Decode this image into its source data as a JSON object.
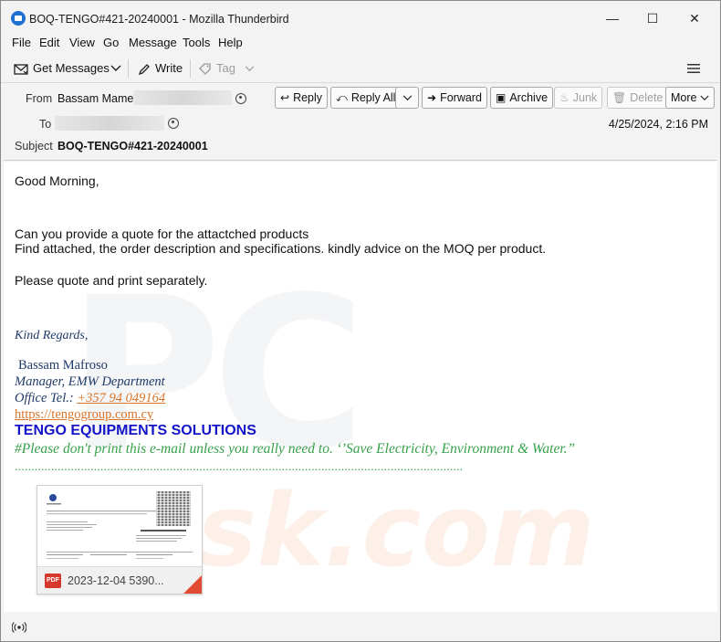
{
  "window": {
    "title": "BOQ-TENGO#421-20240001 - Mozilla Thunderbird",
    "minimize": "—",
    "maximize": "☐",
    "close": "✕"
  },
  "menu": {
    "file": "File",
    "edit": "Edit",
    "view": "View",
    "go": "Go",
    "message": "Message",
    "tools": "Tools",
    "help": "Help"
  },
  "toolbar": {
    "get_messages": "Get Messages",
    "write": "Write",
    "tag": "Tag",
    "menu_icon": "hamburger-icon"
  },
  "header": {
    "from_label": "From",
    "from_name": "Bassam Mamet",
    "to_label": "To",
    "subject_label": "Subject",
    "subject": "BOQ-TENGO#421-20240001",
    "date": "4/25/2024, 2:16 PM",
    "buttons": {
      "reply": "Reply",
      "reply_all": "Reply All",
      "forward": "Forward",
      "archive": "Archive",
      "junk": "Junk",
      "delete": "Delete",
      "more": "More"
    }
  },
  "body": {
    "greeting": "Good Morning,",
    "line1": "Can you provide a quote for the attactched products",
    "line2": "Find attached, the order description and specifications. kindly advice on the MOQ per product.",
    "line3": "Please quote and print separately.",
    "regards": "Kind Regards,",
    "sig_name": "Bassam Mafroso",
    "sig_title": "Manager, EMW Department",
    "office_label": "Office Tel.:",
    "office_phone": "+357 94 049164",
    "website": "https://tengogroup.com.cy",
    "company": "TENGO EQUIPMENTS SOLUTIONS",
    "notice": "#Please don't print this e-mail unless you really need to. ‘’Save Electricity, Environment & Water.”",
    "dots": "........................................................................................................................................"
  },
  "attachment": {
    "badge": "PDF",
    "name": "2023-12-04 5390..."
  },
  "watermark": {
    "text1": "PC",
    "text2": "risk.com"
  }
}
